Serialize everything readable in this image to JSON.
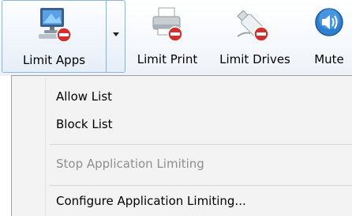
{
  "toolbar": {
    "limit_apps": {
      "label": "Limit Apps",
      "icon": "computer-block-icon"
    },
    "limit_print": {
      "label": "Limit Print",
      "icon": "printer-block-icon"
    },
    "limit_drives": {
      "label": "Limit Drives",
      "icon": "usb-drive-block-icon"
    },
    "mute": {
      "label": "Mute",
      "icon": "speaker-icon"
    }
  },
  "menu": {
    "items": [
      {
        "label": "Allow List",
        "enabled": true
      },
      {
        "label": "Block List",
        "enabled": true
      },
      {
        "label": "Stop Application Limiting",
        "enabled": false
      },
      {
        "label": "Configure Application Limiting...",
        "enabled": true
      }
    ]
  },
  "colors": {
    "badge_red": "#d32f2f",
    "button_border": "#8fb3d9",
    "menu_background": "#f3f3f3",
    "disabled_text": "#8e8e8e"
  }
}
